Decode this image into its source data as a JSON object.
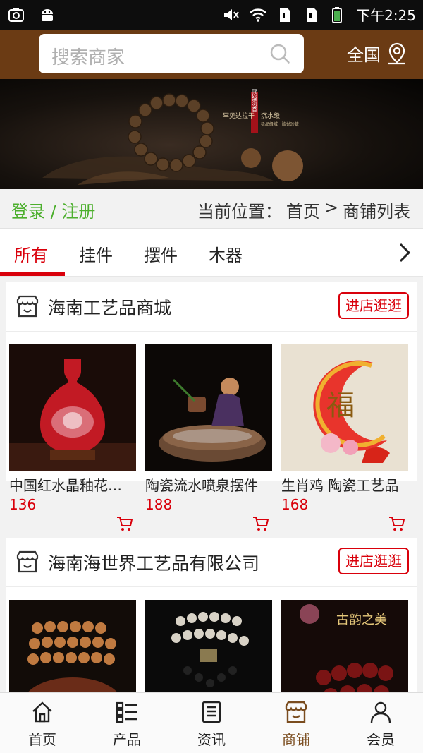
{
  "status_bar": {
    "time": "下午2:25"
  },
  "header": {
    "search_placeholder": "搜索商家",
    "region_label": "全国"
  },
  "banner": {
    "slogan_1": "罕见达拉干",
    "slogan_2": "沉水级",
    "slogan_3": "极品级城 · 破世珍藏",
    "seal": "顶级沉香"
  },
  "breadcrumb": {
    "login_label": "登录 / 注册",
    "prefix": "当前位置：",
    "home": "首页",
    "separator": ">",
    "current": "商铺列表"
  },
  "tabs": [
    {
      "label": "所有",
      "active": true
    },
    {
      "label": "挂件",
      "active": false
    },
    {
      "label": "摆件",
      "active": false
    },
    {
      "label": "木器",
      "active": false
    }
  ],
  "shops": [
    {
      "name": "海南工艺品商城",
      "visit_label": "进店逛逛",
      "products": [
        {
          "title": "中国红水晶釉花…",
          "price": "136"
        },
        {
          "title": "陶瓷流水喷泉摆件",
          "price": "188"
        },
        {
          "title": "生肖鸡 陶瓷工艺品",
          "price": "168"
        }
      ]
    },
    {
      "name": "海南海世界工艺品有限公司",
      "visit_label": "进店逛逛",
      "products": [
        {
          "title": "",
          "price": ""
        },
        {
          "title": "",
          "price": ""
        },
        {
          "title": "古韵之美",
          "price": ""
        }
      ]
    }
  ],
  "tabbar": [
    {
      "label": "首页",
      "icon": "home-icon",
      "active": false
    },
    {
      "label": "产品",
      "icon": "list-icon",
      "active": false
    },
    {
      "label": "资讯",
      "icon": "news-icon",
      "active": false
    },
    {
      "label": "商铺",
      "icon": "store-icon",
      "active": true
    },
    {
      "label": "会员",
      "icon": "user-icon",
      "active": false
    }
  ],
  "colors": {
    "header_bg": "#6b3b14",
    "accent_red": "#d9000b",
    "login_green": "#4caf2d",
    "active_tab_brown": "#7a4c1e"
  }
}
